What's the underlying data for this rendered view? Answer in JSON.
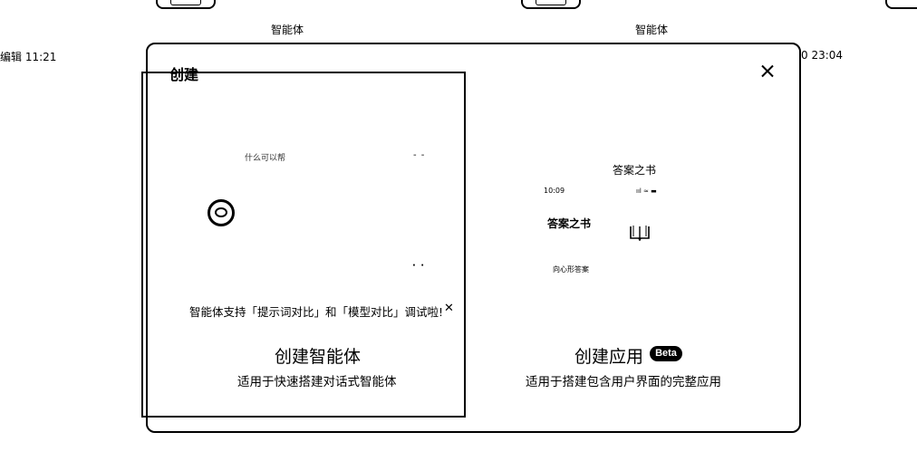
{
  "background": {
    "cards": [
      {
        "label": "智能体"
      },
      {
        "label": "智能体"
      }
    ],
    "left_edited": "编辑 11:21",
    "right_edited": "0 23:04"
  },
  "modal": {
    "title": "创建",
    "close_icon": "close-icon"
  },
  "agent_card": {
    "preview_caption": "什么可以帮",
    "preview_dots_top": "- -",
    "preview_dots_bottom": "· ·",
    "notice": "智能体支持「提示词对比」和「模型对比」调试啦!",
    "notice_close": "✕",
    "title": "创建智能体",
    "description": "适用于快速搭建对话式智能体"
  },
  "app_card": {
    "preview_title": "答案之书",
    "preview_time": "10:09",
    "preview_status": "ııl ≈ ▬",
    "preview_heading": "答案之书",
    "preview_small": "向心形答案",
    "title": "创建应用",
    "badge": "Beta",
    "description": "适用于搭建包含用户界面的完整应用"
  }
}
